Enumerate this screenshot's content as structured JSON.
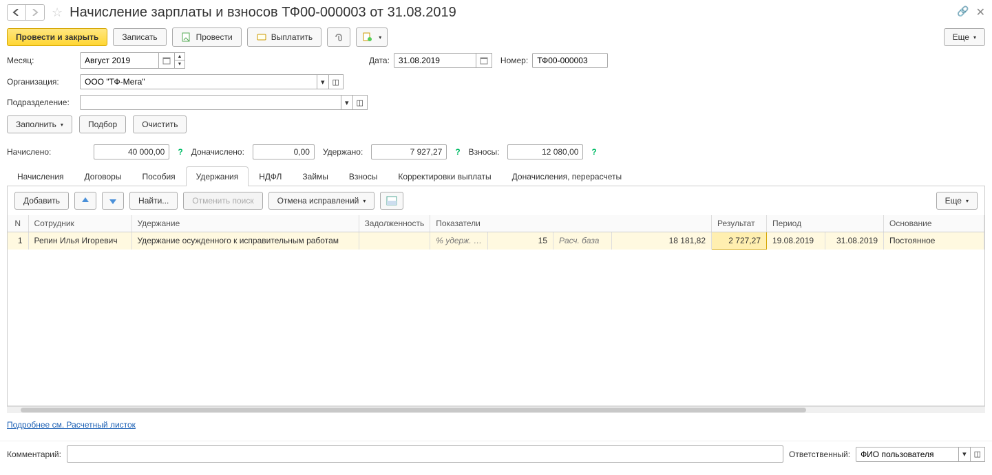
{
  "header": {
    "title": "Начисление зарплаты и взносов ТФ00-000003 от 31.08.2019"
  },
  "toolbar": {
    "post_close": "Провести и закрыть",
    "save": "Записать",
    "post": "Провести",
    "pay": "Выплатить",
    "more": "Еще"
  },
  "form": {
    "month_label": "Месяц:",
    "month_value": "Август 2019",
    "date_label": "Дата:",
    "date_value": "31.08.2019",
    "number_label": "Номер:",
    "number_value": "ТФ00-000003",
    "org_label": "Организация:",
    "org_value": "ООО \"ТФ-Мега\"",
    "dept_label": "Подразделение:",
    "dept_value": ""
  },
  "actions": {
    "fill": "Заполнить",
    "pick": "Подбор",
    "clear": "Очистить"
  },
  "summary": {
    "accrued_label": "Начислено:",
    "accrued_value": "40 000,00",
    "extra_label": "Доначислено:",
    "extra_value": "0,00",
    "withheld_label": "Удержано:",
    "withheld_value": "7 927,27",
    "contrib_label": "Взносы:",
    "contrib_value": "12 080,00"
  },
  "tabs": [
    "Начисления",
    "Договоры",
    "Пособия",
    "Удержания",
    "НДФЛ",
    "Займы",
    "Взносы",
    "Корректировки выплаты",
    "Доначисления, перерасчеты"
  ],
  "tabs_active": 3,
  "subtoolbar": {
    "add": "Добавить",
    "find": "Найти...",
    "cancel_search": "Отменить поиск",
    "cancel_fix": "Отмена исправлений",
    "more": "Еще"
  },
  "table": {
    "headers": [
      "N",
      "Сотрудник",
      "Удержание",
      "Задолженность",
      "Показатели",
      "",
      "",
      "",
      "Результат",
      "Период",
      "",
      "Основание"
    ],
    "row": {
      "n": "1",
      "employee": "Репин Илья Игоревич",
      "deduction": "Удержание осужденного к исправительным работам",
      "debt": "",
      "ind_label": "% удерж. …",
      "ind_val": "15",
      "base_label": "Расч. база",
      "base_val": "18 181,82",
      "result": "2 727,27",
      "period_from": "19.08.2019",
      "period_to": "31.08.2019",
      "basis": "Постоянное"
    }
  },
  "link_more": "Подробнее см. Расчетный листок",
  "footer": {
    "comment_label": "Комментарий:",
    "comment_value": "",
    "resp_label": "Ответственный:",
    "resp_value": "ФИО пользователя"
  }
}
